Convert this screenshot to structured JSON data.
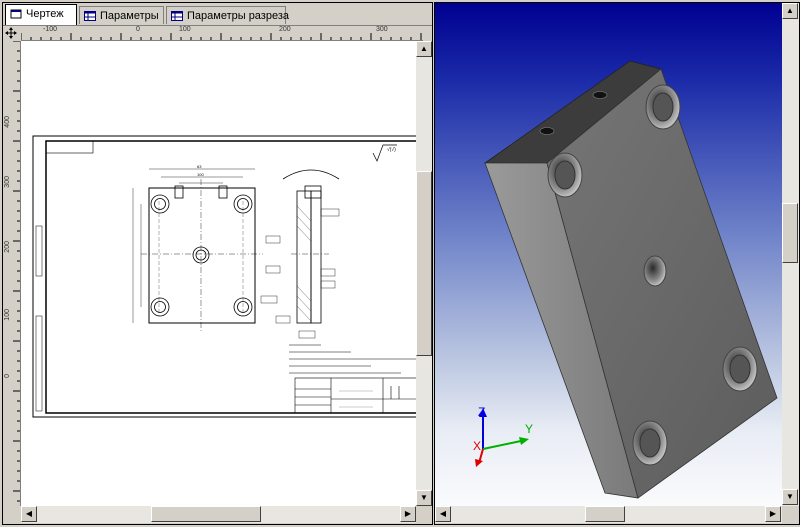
{
  "tabs": [
    {
      "label": "Чертеж",
      "active": true,
      "icon": "drawing-sheet-icon"
    },
    {
      "label": "Параметры",
      "active": false,
      "icon": "table-icon"
    },
    {
      "label": "Параметры разреза",
      "active": false,
      "icon": "table-icon"
    }
  ],
  "ruler_top_ticks": [
    "-100",
    "0",
    "100",
    "200",
    "300"
  ],
  "ruler_left_ticks": [
    "400",
    "300",
    "200",
    "100",
    "0"
  ],
  "axes": {
    "x": "X",
    "y": "Y",
    "z": "Z"
  },
  "colors": {
    "axis_x": "#e00000",
    "axis_y": "#00b000",
    "axis_z": "#0000e0",
    "part_face": "#6a6a6a",
    "part_top": "#3a3a3a",
    "part_side": "#8a8a8a"
  }
}
